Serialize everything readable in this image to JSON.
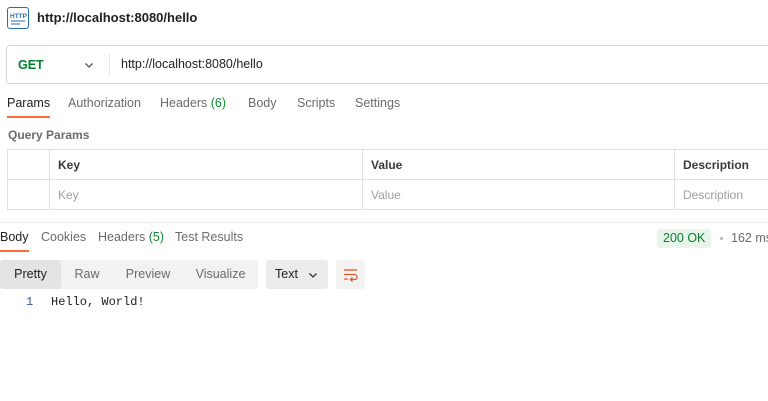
{
  "window": {
    "title": "http://localhost:8080/hello",
    "icon": "http-icon"
  },
  "request": {
    "method": "GET",
    "url": "http://localhost:8080/hello",
    "tabs": {
      "params": "Params",
      "authorization": "Authorization",
      "headers": "Headers",
      "headers_count": "(6)",
      "body": "Body",
      "scripts": "Scripts",
      "settings": "Settings"
    },
    "active_tab": "Params"
  },
  "query_params": {
    "label": "Query Params",
    "columns": {
      "key": "Key",
      "value": "Value",
      "description": "Description"
    },
    "placeholders": {
      "key": "Key",
      "value": "Value",
      "description": "Description"
    }
  },
  "response": {
    "tabs": {
      "body": "Body",
      "cookies": "Cookies",
      "headers": "Headers",
      "headers_count": "(5)",
      "test_results": "Test Results"
    },
    "active_tab": "Body",
    "status": "200 OK",
    "time": "162 ms",
    "views": {
      "pretty": "Pretty",
      "raw": "Raw",
      "preview": "Preview",
      "visualize": "Visualize"
    },
    "active_view": "Pretty",
    "format": "Text",
    "lines": [
      {
        "number": "1",
        "text": "Hello, World!"
      }
    ]
  },
  "colors": {
    "accent": "#ff6c37",
    "method_get": "#007f31",
    "status_ok": "#0f7a32"
  }
}
